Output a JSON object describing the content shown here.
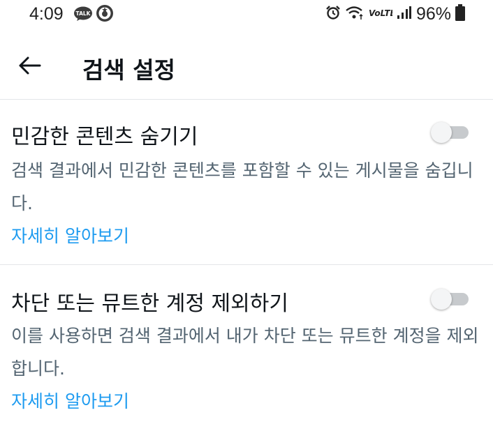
{
  "status_bar": {
    "time": "4:09",
    "talk_badge": "TALK",
    "network_label": "VoLTE",
    "battery_percent": "96%"
  },
  "header": {
    "title": "검색 설정"
  },
  "settings": [
    {
      "title": "민감한 콘텐츠 숨기기",
      "description": "검색 결과에서 민감한 콘텐츠를 포함할 수 있는 게시물을 숨깁니다.",
      "link": "자세히 알아보기",
      "enabled": false
    },
    {
      "title": "차단 또는 뮤트한 계정 제외하기",
      "description": "이를 사용하면 검색 결과에서 내가 차단 또는 뮤트한 계정을 제외합니다.",
      "link": "자세히 알아보기",
      "enabled": false
    }
  ],
  "colors": {
    "link": "#1d9bf0",
    "secondary_text": "#536471",
    "primary_text": "#0f1419",
    "toggle_off_track": "#c7cacd"
  }
}
